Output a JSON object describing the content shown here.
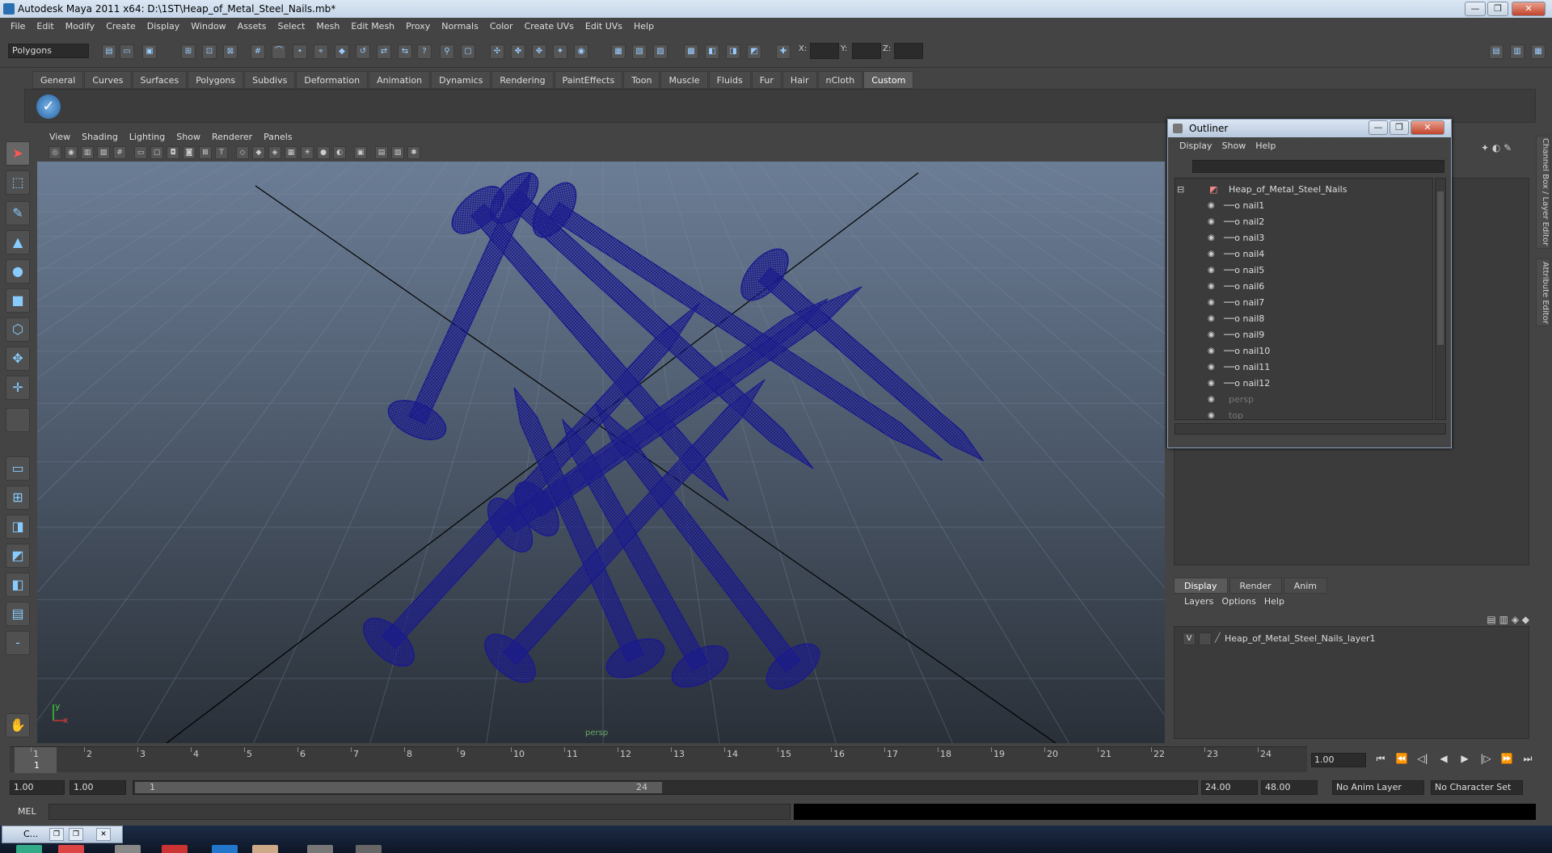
{
  "window": {
    "title": "Autodesk Maya 2011 x64: D:\\1ST\\Heap_of_Metal_Steel_Nails.mb*",
    "buttons": [
      "—",
      "❐",
      "✕"
    ]
  },
  "menubar": [
    "File",
    "Edit",
    "Modify",
    "Create",
    "Display",
    "Window",
    "Assets",
    "Select",
    "Mesh",
    "Edit Mesh",
    "Proxy",
    "Normals",
    "Color",
    "Create UVs",
    "Edit UVs",
    "Help"
  ],
  "statusline": {
    "mode": "Polygons",
    "x_label": "X:",
    "y_label": "Y:",
    "z_label": "Z:"
  },
  "shelf": {
    "tabs": [
      "General",
      "Curves",
      "Surfaces",
      "Polygons",
      "Subdivs",
      "Deformation",
      "Animation",
      "Dynamics",
      "Rendering",
      "PaintEffects",
      "Toon",
      "Muscle",
      "Fluids",
      "Fur",
      "Hair",
      "nCloth",
      "Custom"
    ],
    "active_tab": "Custom",
    "button_icon": "check-icon"
  },
  "viewport": {
    "menu": [
      "View",
      "Shading",
      "Lighting",
      "Show",
      "Renderer",
      "Panels"
    ],
    "camera": "persp",
    "axis_y": "y",
    "axis_x": "x",
    "wire_color": "#1a1a8c"
  },
  "outliner": {
    "title": "Outliner",
    "menu": [
      "Display",
      "Show",
      "Help"
    ],
    "root": "Heap_of_Metal_Steel_Nails",
    "items": [
      "nail1",
      "nail2",
      "nail3",
      "nail4",
      "nail5",
      "nail6",
      "nail7",
      "nail8",
      "nail9",
      "nail10",
      "nail11",
      "nail12"
    ],
    "cameras": [
      "persp",
      "top"
    ]
  },
  "sidetabs": [
    "Channel Box / Layer Editor",
    "Attribute Editor"
  ],
  "layers": {
    "tabs": [
      "Display",
      "Render",
      "Anim"
    ],
    "active_tab": "Display",
    "menu": [
      "Layers",
      "Options",
      "Help"
    ],
    "rows": [
      {
        "visible": "V",
        "name": "Heap_of_Metal_Steel_Nails_layer1"
      }
    ]
  },
  "timeline": {
    "ticks": [
      "1",
      "2",
      "3",
      "4",
      "5",
      "6",
      "7",
      "8",
      "9",
      "10",
      "11",
      "12",
      "13",
      "14",
      "15",
      "16",
      "17",
      "18",
      "19",
      "20",
      "21",
      "22",
      "23",
      "24"
    ],
    "current_frame": "1",
    "time_field": "1.00"
  },
  "range": {
    "start": "1.00",
    "playback_start": "1.00",
    "slider_start": "1",
    "slider_end": "24",
    "playback_end": "24.00",
    "end": "48.00",
    "anim_layer": "No Anim Layer",
    "character_set": "No Character Set"
  },
  "commandline": {
    "label": "MEL"
  },
  "taskbar": {
    "minimized_title": "C..."
  }
}
